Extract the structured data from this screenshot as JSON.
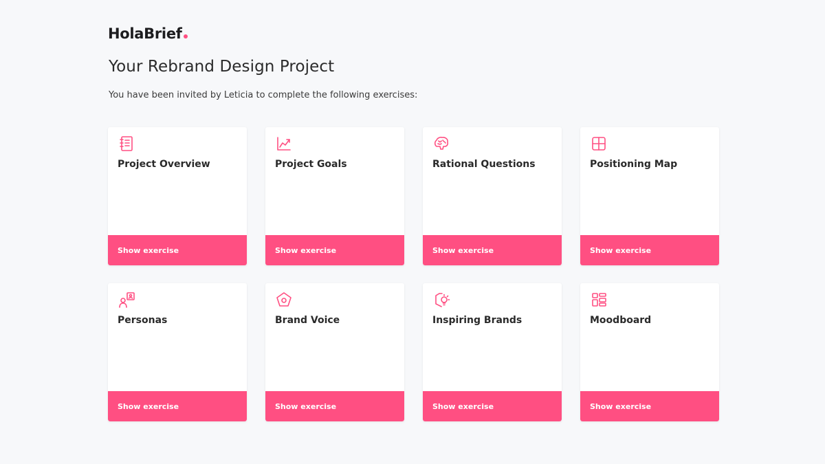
{
  "brand": {
    "name": "HolaBrief",
    "accent_color": "#ff4f82"
  },
  "header": {
    "title": "Your Rebrand Design Project",
    "subtitle": "You have been invited by Leticia to complete the following exercises:"
  },
  "cards": [
    {
      "title": "Project Overview",
      "icon": "notebook-icon",
      "button_label": "Show exercise"
    },
    {
      "title": "Project Goals",
      "icon": "trend-chart-icon",
      "button_label": "Show exercise"
    },
    {
      "title": "Rational Questions",
      "icon": "brain-icon",
      "button_label": "Show exercise"
    },
    {
      "title": "Positioning Map",
      "icon": "grid-quadrant-icon",
      "button_label": "Show exercise"
    },
    {
      "title": "Personas",
      "icon": "persona-icon",
      "button_label": "Show exercise"
    },
    {
      "title": "Brand Voice",
      "icon": "pentagon-icon",
      "button_label": "Show exercise"
    },
    {
      "title": "Inspiring Brands",
      "icon": "lightbulb-hexagon-icon",
      "button_label": "Show exercise"
    },
    {
      "title": "Moodboard",
      "icon": "layout-blocks-icon",
      "button_label": "Show exercise"
    }
  ]
}
